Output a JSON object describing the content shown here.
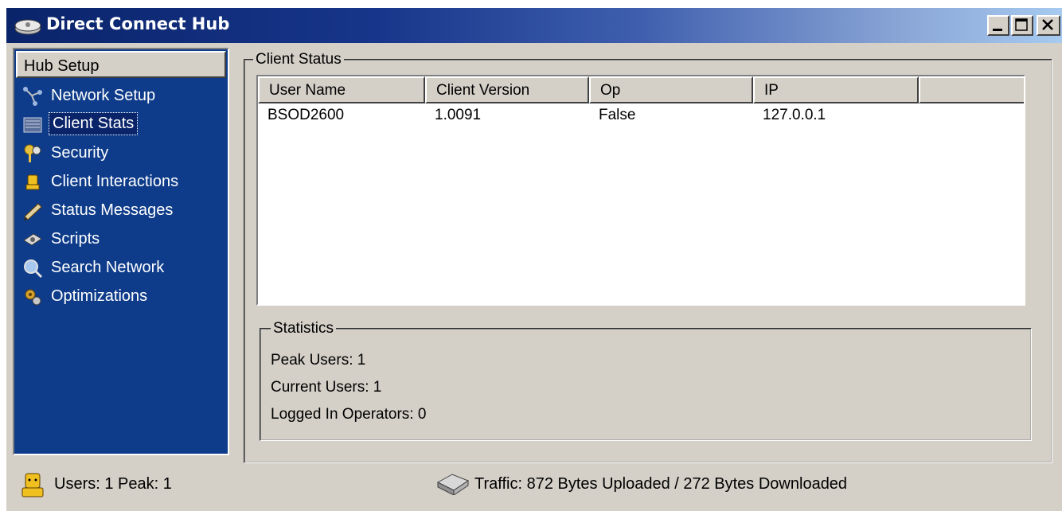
{
  "window": {
    "title": "Direct Connect Hub",
    "controls": [
      "minimize-icon",
      "maximize-icon",
      "close-icon"
    ]
  },
  "sidebar": {
    "header": "Hub Setup",
    "items": [
      {
        "label": "Network Setup",
        "icon": "network-icon"
      },
      {
        "label": "Client Stats",
        "icon": "client-stats-icon",
        "selected": true
      },
      {
        "label": "Security",
        "icon": "keys-icon"
      },
      {
        "label": "Client Interactions",
        "icon": "person-icon"
      },
      {
        "label": "Status Messages",
        "icon": "messages-icon"
      },
      {
        "label": "Scripts",
        "icon": "scripts-icon"
      },
      {
        "label": "Search Network",
        "icon": "search-icon"
      },
      {
        "label": "Optimizations",
        "icon": "optimizations-icon"
      }
    ]
  },
  "client_status": {
    "title": "Client Status",
    "columns": [
      "User Name",
      "Client Version",
      "Op",
      "IP",
      ""
    ],
    "rows": [
      [
        "BSOD2600",
        "1.0091",
        "False",
        "127.0.0.1",
        ""
      ]
    ]
  },
  "statistics": {
    "title": "Statistics",
    "peak_users": "Peak Users: 1",
    "current_users": "Current Users: 1",
    "logged_in_operators": "Logged In Operators: 0"
  },
  "status_bar": {
    "users": "Users: 1 Peak: 1",
    "traffic": "Traffic: 872 Bytes Uploaded  /  272 Bytes Downloaded"
  },
  "colors": {
    "sidebar_bg": "#0e3c8a",
    "title_dark": "#0a246a",
    "window_face": "#d4d0c8"
  }
}
